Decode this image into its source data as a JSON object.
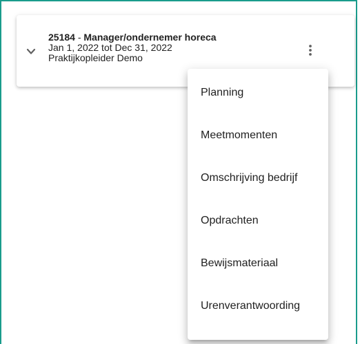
{
  "enrollment": {
    "course_id": "25184",
    "separator": " - ",
    "course_name": "Manager/ondernemer horeca",
    "period": "Jan 1, 2022 tot Dec 31, 2022",
    "supervisor": "Praktijkopleider Demo"
  },
  "icons": {
    "expand": "chevron-down-icon",
    "more": "more-vert-icon"
  },
  "menu": {
    "items": [
      {
        "label": "Planning"
      },
      {
        "label": "Meetmomenten"
      },
      {
        "label": "Omschrijving bedrijf"
      },
      {
        "label": "Opdrachten"
      },
      {
        "label": "Bewijsmateriaal"
      },
      {
        "label": "Urenverantwoording"
      }
    ]
  },
  "colors": {
    "frame_border": "#1a9c8c",
    "text": "#212121",
    "icon": "#616161"
  }
}
